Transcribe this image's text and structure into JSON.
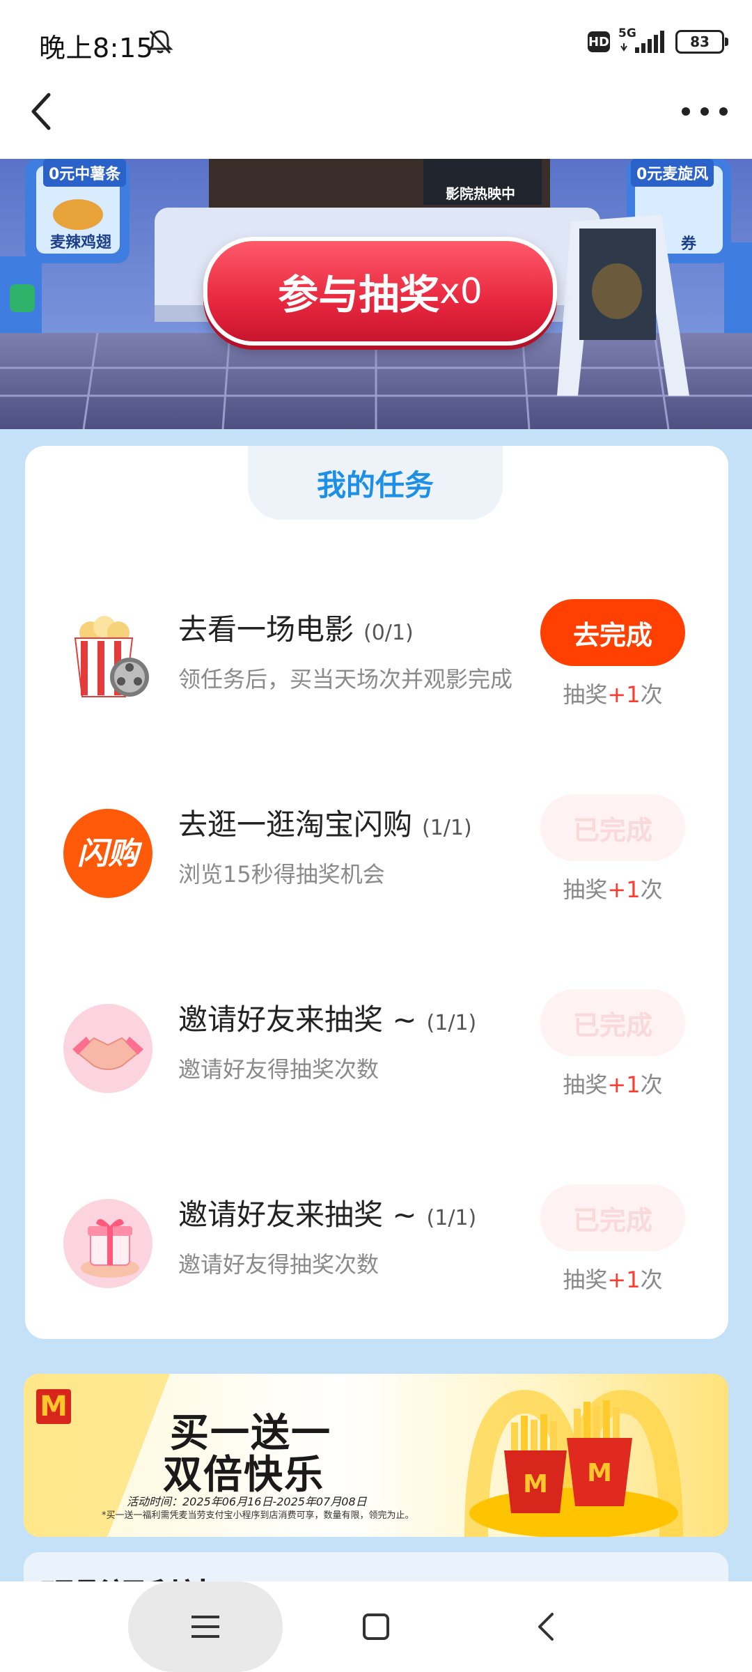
{
  "status_bar": {
    "time": "晚上8:15",
    "hd": "HD",
    "network": "5G",
    "battery": "83"
  },
  "banner": {
    "draw_label": "参与抽奖",
    "draw_count": "x0",
    "prize_left_top": "0元中薯条",
    "prize_left_bottom": "麦辣鸡翅",
    "prize_right_top": "0元麦旋风",
    "prize_right_bottom": "券",
    "screen_text": "影院热映中"
  },
  "tasks": {
    "header": "我的任务",
    "items": [
      {
        "title": "去看一场电影",
        "progress": "(0/1)",
        "desc": "领任务后，买当天场次并观影完成",
        "button": "去完成",
        "reward_prefix": "抽奖",
        "reward_plus": "+1",
        "reward_suffix": "次"
      },
      {
        "title": "去逛一逛淘宝闪购",
        "progress": "(1/1)",
        "desc": "浏览15秒得抽奖机会",
        "button": "已完成",
        "icon_text": "闪购",
        "reward_prefix": "抽奖",
        "reward_plus": "+1",
        "reward_suffix": "次"
      },
      {
        "title": "邀请好友来抽奖 ~",
        "progress": "(1/1)",
        "desc": "邀请好友得抽奖次数",
        "button": "已完成",
        "reward_prefix": "抽奖",
        "reward_plus": "+1",
        "reward_suffix": "次"
      },
      {
        "title": "邀请好友来抽奖 ~",
        "progress": "(1/1)",
        "desc": "邀请好友得抽奖次数",
        "button": "已完成",
        "reward_prefix": "抽奖",
        "reward_plus": "+1",
        "reward_suffix": "次"
      }
    ]
  },
  "promo": {
    "logo": "M",
    "title_line1": "买一送一",
    "title_line2": "双倍快乐",
    "date": "活动时间：2025年06月16日-2025年07月08日",
    "note": "*买一送一福利需凭麦当劳支付宝小程序到店消费可享，数量有限，领完为止。"
  },
  "next_section": {
    "title": "观影福利站"
  },
  "colors": {
    "accent_orange": "#ff4000",
    "tab_blue": "#1d8fe6",
    "page_bg": "#c5e1f7"
  }
}
